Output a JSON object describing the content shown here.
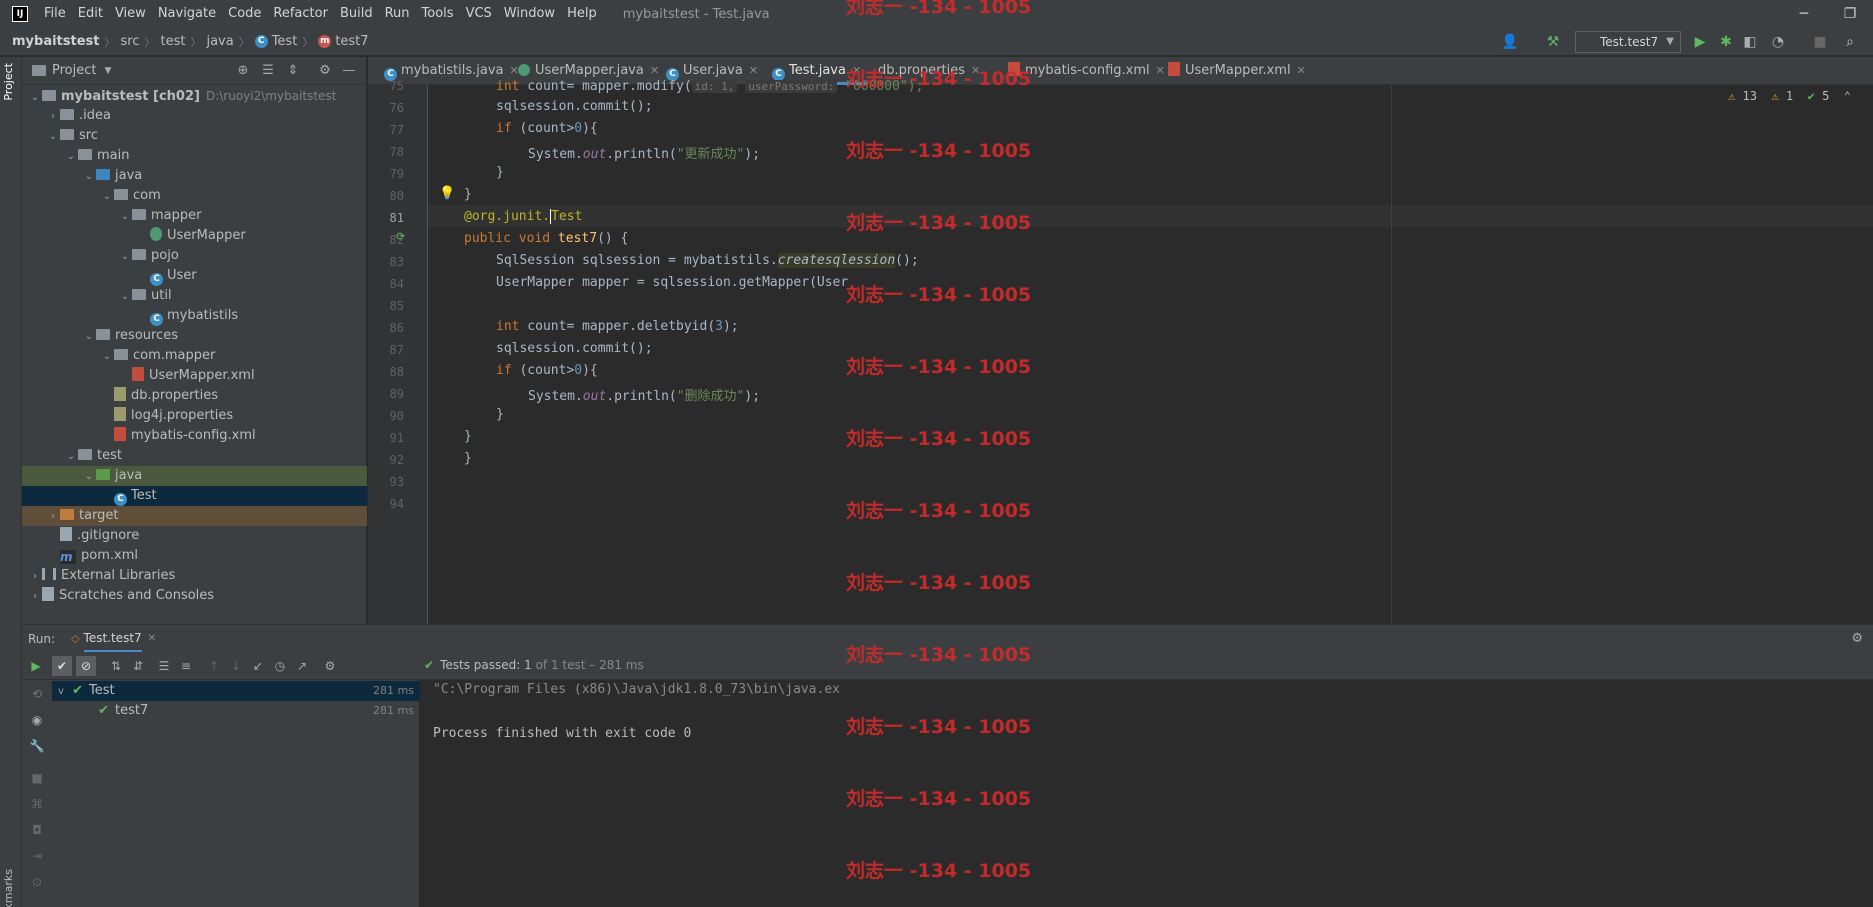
{
  "window": {
    "logo": "IJ",
    "title": "mybaitstest - Test.java",
    "controls": [
      "─",
      "❐",
      "✕"
    ]
  },
  "menu": [
    "File",
    "Edit",
    "View",
    "Navigate",
    "Code",
    "Refactor",
    "Build",
    "Run",
    "Tools",
    "VCS",
    "Window",
    "Help"
  ],
  "breadcrumb": {
    "project": "mybaitstest",
    "items": [
      "src",
      "test",
      "java"
    ],
    "class": "Test",
    "method": "test7"
  },
  "run_config": "Test.test7",
  "project_panel": {
    "title": "Project",
    "tree": [
      {
        "label": "mybaitstest [ch02]",
        "extra": "D:\\ruoyi2\\mybaitstest",
        "indent": 0,
        "arrow": "v",
        "icon": "folder"
      },
      {
        "label": ".idea",
        "indent": 1,
        "arrow": ">",
        "icon": "folder"
      },
      {
        "label": "src",
        "indent": 1,
        "arrow": "v",
        "icon": "folder"
      },
      {
        "label": "main",
        "indent": 2,
        "arrow": "v",
        "icon": "folder"
      },
      {
        "label": "java",
        "indent": 3,
        "arrow": "v",
        "icon": "folder-blue"
      },
      {
        "label": "com",
        "indent": 4,
        "arrow": "v",
        "icon": "folder"
      },
      {
        "label": "mapper",
        "indent": 5,
        "arrow": "v",
        "icon": "folder"
      },
      {
        "label": "UserMapper",
        "indent": 6,
        "arrow": "",
        "icon": "iface"
      },
      {
        "label": "pojo",
        "indent": 5,
        "arrow": "v",
        "icon": "folder"
      },
      {
        "label": "User",
        "indent": 6,
        "arrow": "",
        "icon": "class"
      },
      {
        "label": "util",
        "indent": 5,
        "arrow": "v",
        "icon": "folder"
      },
      {
        "label": "mybatistils",
        "indent": 6,
        "arrow": "",
        "icon": "class"
      },
      {
        "label": "resources",
        "indent": 3,
        "arrow": "v",
        "icon": "folder"
      },
      {
        "label": "com.mapper",
        "indent": 4,
        "arrow": "v",
        "icon": "folder"
      },
      {
        "label": "UserMapper.xml",
        "indent": 5,
        "arrow": "",
        "icon": "xml"
      },
      {
        "label": "db.properties",
        "indent": 4,
        "arrow": "",
        "icon": "props"
      },
      {
        "label": "log4j.properties",
        "indent": 4,
        "arrow": "",
        "icon": "props"
      },
      {
        "label": "mybatis-config.xml",
        "indent": 4,
        "arrow": "",
        "icon": "xml"
      },
      {
        "label": "test",
        "indent": 2,
        "arrow": "v",
        "icon": "folder"
      },
      {
        "label": "java",
        "indent": 3,
        "arrow": "v",
        "icon": "folder-green",
        "state": "sel-gray"
      },
      {
        "label": "Test",
        "indent": 4,
        "arrow": "",
        "icon": "class",
        "state": "sel-dark"
      },
      {
        "label": "target",
        "indent": 1,
        "arrow": ">",
        "icon": "folder-orange",
        "state": "hl-orange"
      },
      {
        "label": ".gitignore",
        "indent": 1,
        "arrow": "",
        "icon": "file"
      },
      {
        "label": "pom.xml",
        "indent": 1,
        "arrow": "",
        "icon": "pom"
      },
      {
        "label": "External Libraries",
        "indent": 0,
        "arrow": ">",
        "icon": "lib"
      },
      {
        "label": "Scratches and Consoles",
        "indent": 0,
        "arrow": ">",
        "icon": "scratch"
      }
    ]
  },
  "side_tabs": {
    "project": "Project",
    "bookmarks": "Bookmarks"
  },
  "editor_tabs": [
    {
      "label": "mybatistils.java",
      "icon": "C"
    },
    {
      "label": "UserMapper.java",
      "icon": "I"
    },
    {
      "label": "User.java",
      "icon": "C"
    },
    {
      "label": "Test.java",
      "icon": "C",
      "active": true
    },
    {
      "label": "db.properties",
      "icon": "P"
    },
    {
      "label": "mybatis-config.xml",
      "icon": "X"
    },
    {
      "label": "UserMapper.xml",
      "icon": "X"
    }
  ],
  "inspections": {
    "warnings": "13",
    "weak": "1",
    "ok": "5"
  },
  "code": {
    "line_numbers": [
      "75",
      "76",
      "77",
      "78",
      "79",
      "80",
      "81",
      "82",
      "83",
      "84",
      "85",
      "86",
      "87",
      "88",
      "89",
      "90",
      "91",
      "92",
      "93",
      "94"
    ],
    "l75_a": "int",
    "l75_b": " count= mapper.modify(",
    "l75_hint1": "id: 1,",
    "l75_hint2": "userPassword:",
    "l75_str": " \"000000\");",
    "l76": "sqlsession.commit();",
    "l77_kw": "if",
    "l77_rest": " (count>",
    "l77_num": "0",
    "l77_end": "){",
    "l78_a": "System.",
    "l78_out": "out",
    "l78_b": ".println(",
    "l78_str": "\"更新成功\"",
    "l78_c": ");",
    "l79": "}",
    "l80": "}",
    "l81_ann": "@org.junit.",
    "l81_test": "Test",
    "l82_kw": "public void",
    "l82_fn": " test7",
    "l82_rest": "() {",
    "l83_a": "SqlSession sqlsession = mybatistils.",
    "l83_b": "createsqlession",
    "l83_c": "();",
    "l84": "UserMapper mapper = sqlsession.getMapper(User",
    "l86_kw": "int",
    "l86_a": " count= mapper.deletbyid(",
    "l86_num": "3",
    "l86_b": ");",
    "l87": "sqlsession.commit();",
    "l88_kw": "if",
    "l88_rest": " (count>",
    "l88_num": "0",
    "l88_end": "){",
    "l89_a": "System.",
    "l89_out": "out",
    "l89_b": ".println(",
    "l89_str": "\"删除成功\"",
    "l89_c": ");",
    "l90": "}",
    "l91": "}",
    "l92": "}"
  },
  "run_panel": {
    "label": "Run:",
    "tab": "Test.test7",
    "status_prefix": "Tests passed:",
    "status_count": "1",
    "status_suffix": "of 1 test – 281 ms",
    "tests": [
      {
        "name": "Test",
        "time": "281 ms"
      },
      {
        "name": "test7",
        "time": "281 ms"
      }
    ],
    "console": [
      "\"C:\\Program Files (x86)\\Java\\jdk1.8.0_73\\bin\\java.ex",
      "",
      "Process finished with exit code 0"
    ]
  },
  "watermark": "刘志一 -134 - 1005",
  "colors": {
    "accent": "#4a88c7",
    "watermark": "#cc2b2b",
    "pass": "#5fb85f",
    "keyword": "#cc7832",
    "string": "#6a8759"
  }
}
